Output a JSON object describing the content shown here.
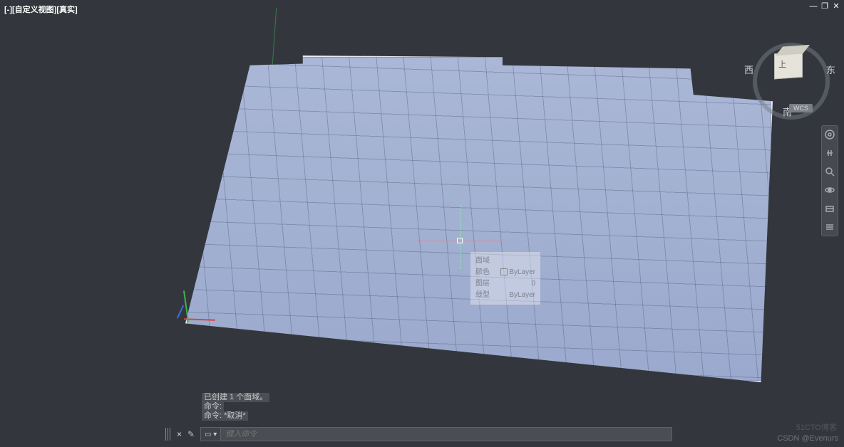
{
  "view_label": "[-][自定义视图][真实]",
  "window_controls": {
    "min": "—",
    "max": "❐",
    "close": "✕"
  },
  "viewcube": {
    "top_face": "上",
    "north": "南",
    "south": "南",
    "west": "西",
    "east": "东",
    "coord_system": "WCS"
  },
  "tooltip": {
    "title": "面域",
    "rows": [
      {
        "k": "颜色",
        "v": "ByLayer",
        "swatch": true
      },
      {
        "k": "图层",
        "v": "0"
      },
      {
        "k": "线型",
        "v": "ByLayer"
      }
    ]
  },
  "cmd_history": [
    "已创建 1 个面域。",
    "命令:",
    "命令: *取消*"
  ],
  "cmd_input_placeholder": "键入命令",
  "nav_tools": [
    "steering-wheel",
    "pan",
    "orbit",
    "zoom",
    "show-motion",
    "menu"
  ],
  "watermark": "CSDN @Evenurs",
  "watermark2": "51CTO博客"
}
